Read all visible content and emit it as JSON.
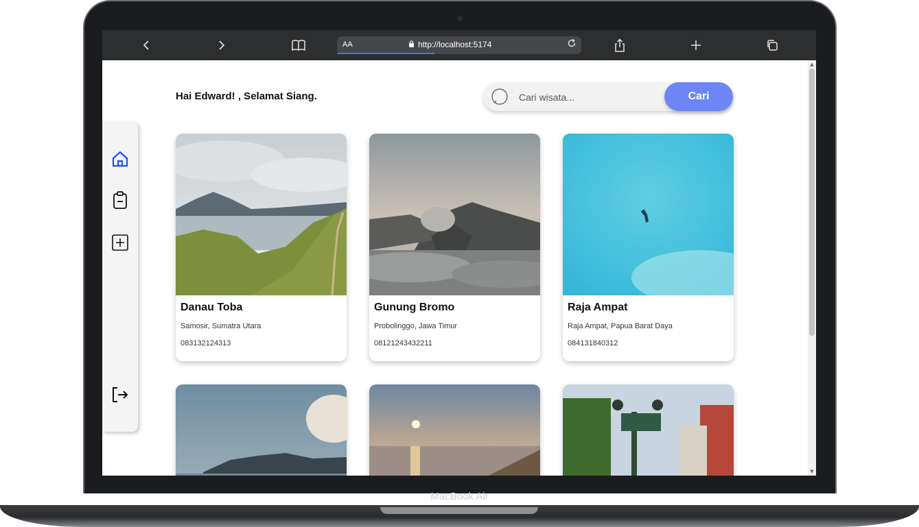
{
  "device": {
    "label": "MacBook Air"
  },
  "browser": {
    "text_size_label": "AA",
    "url": "http://localhost:5174"
  },
  "page": {
    "greeting": "Hai Edward! , Selamat Siang.",
    "search": {
      "placeholder": "Cari wisata...",
      "button_label": "Cari"
    }
  },
  "sidebar": {
    "items": [
      {
        "name": "home",
        "icon": "home-icon",
        "active": true,
        "color": "#1a4dff"
      },
      {
        "name": "clipboard",
        "icon": "clipboard-icon",
        "active": false
      },
      {
        "name": "add",
        "icon": "plus-square-icon",
        "active": false
      },
      {
        "name": "logout",
        "icon": "logout-icon",
        "active": false
      }
    ]
  },
  "destinations": [
    {
      "title": "Danau Toba",
      "location": "Samosir, Sumatra Utara",
      "phone": "083132124313"
    },
    {
      "title": "Gunung Bromo",
      "location": "Probolinggo, Jawa Timur",
      "phone": "08121243432211"
    },
    {
      "title": "Raja Ampat",
      "location": "Raja Ampat, Papua Barat Daya",
      "phone": "084131840312"
    },
    {
      "title": "",
      "location": "",
      "phone": ""
    },
    {
      "title": "",
      "location": "",
      "phone": ""
    },
    {
      "title": "",
      "location": "",
      "phone": ""
    }
  ],
  "colors": {
    "accent": "#6e86f5",
    "active_icon": "#1a4dff"
  }
}
